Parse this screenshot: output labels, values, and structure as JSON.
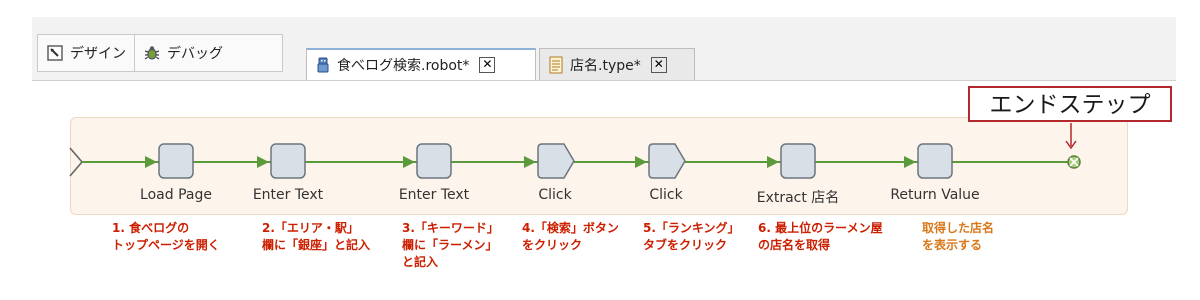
{
  "mode_bar": {
    "design_label": "デザイン",
    "debug_label": "デバッグ"
  },
  "tabs": [
    {
      "label": "食べログ検索.robot*",
      "active": true
    },
    {
      "label": "店名.type*",
      "active": false
    }
  ],
  "steps": [
    {
      "label": "Load Page",
      "shape": "node"
    },
    {
      "label": "Enter Text",
      "shape": "node"
    },
    {
      "label": "Enter Text",
      "shape": "node"
    },
    {
      "label": "Click",
      "shape": "pentagon"
    },
    {
      "label": "Click",
      "shape": "pentagon"
    },
    {
      "label": "Extract 店名",
      "shape": "node"
    },
    {
      "label": "Return Value",
      "shape": "node"
    }
  ],
  "annotations": [
    {
      "lines": [
        "1. 食べログの",
        "トップページを開く"
      ],
      "color": "red"
    },
    {
      "lines": [
        "2.「エリア・駅」",
        "欄に「銀座」と記入"
      ],
      "color": "red"
    },
    {
      "lines": [
        "3.「キーワード」",
        "欄に「ラーメン」",
        "と記入"
      ],
      "color": "red"
    },
    {
      "lines": [
        "4.「検索」ボタン",
        "をクリック"
      ],
      "color": "red"
    },
    {
      "lines": [
        "5.「ランキング」",
        "タブをクリック"
      ],
      "color": "red"
    },
    {
      "lines": [
        "6. 最上位のラーメン屋",
        "の店名を取得"
      ],
      "color": "red"
    },
    {
      "lines": [
        "取得した店名",
        "を表示する"
      ],
      "color": "orange"
    }
  ],
  "callout": {
    "label": "エンドステップ"
  },
  "colors": {
    "flow_line": "#5a9a3a",
    "annotation_red": "#cc1f00",
    "annotation_orange": "#d8781a",
    "callout_border": "#b3282d"
  }
}
